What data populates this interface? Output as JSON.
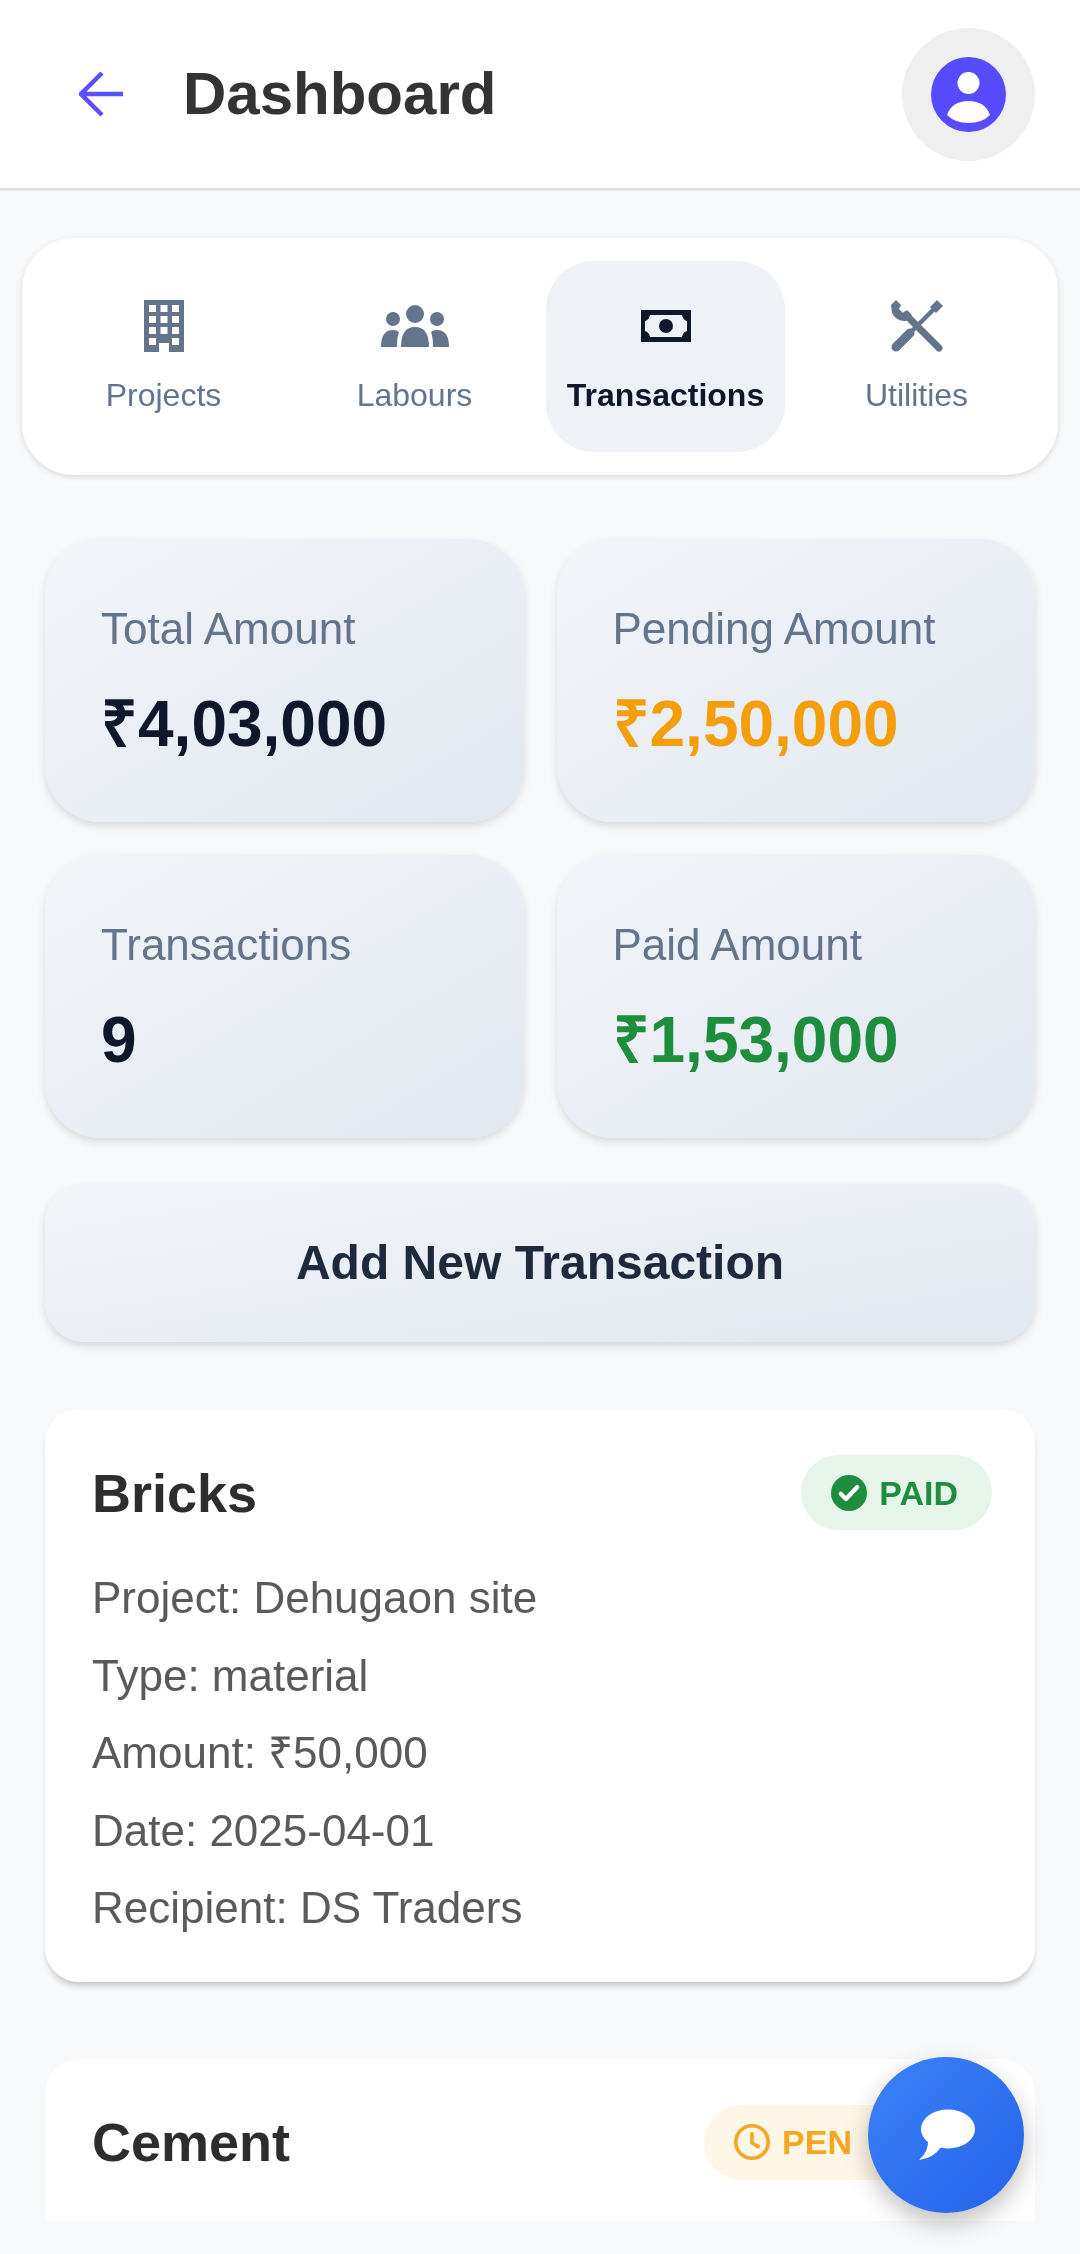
{
  "header": {
    "title": "Dashboard"
  },
  "tabs": [
    {
      "label": "Projects",
      "selected": false
    },
    {
      "label": "Labours",
      "selected": false
    },
    {
      "label": "Transactions",
      "selected": true
    },
    {
      "label": "Utilities",
      "selected": false
    }
  ],
  "stats": [
    {
      "label": "Total Amount",
      "value": "₹4,03,000",
      "color": "#0f172a"
    },
    {
      "label": "Pending Amount",
      "value": "₹2,50,000",
      "color": "#f59e0b"
    },
    {
      "label": "Transactions",
      "value": "9",
      "color": "#0f172a"
    },
    {
      "label": "Paid Amount",
      "value": "₹1,53,000",
      "color": "#1e8e3e"
    }
  ],
  "add_button": {
    "label": "Add New Transaction"
  },
  "transactions": [
    {
      "title": "Bricks",
      "status": {
        "kind": "paid",
        "label": "PAID"
      },
      "details": [
        "Project: Dehugaon site",
        "Type: material",
        "Amount: ₹50,000",
        "Date: 2025-04-01",
        "Recipient: DS Traders"
      ]
    },
    {
      "title": "Cement",
      "status": {
        "kind": "pending",
        "label": "PEN"
      }
    }
  ]
}
